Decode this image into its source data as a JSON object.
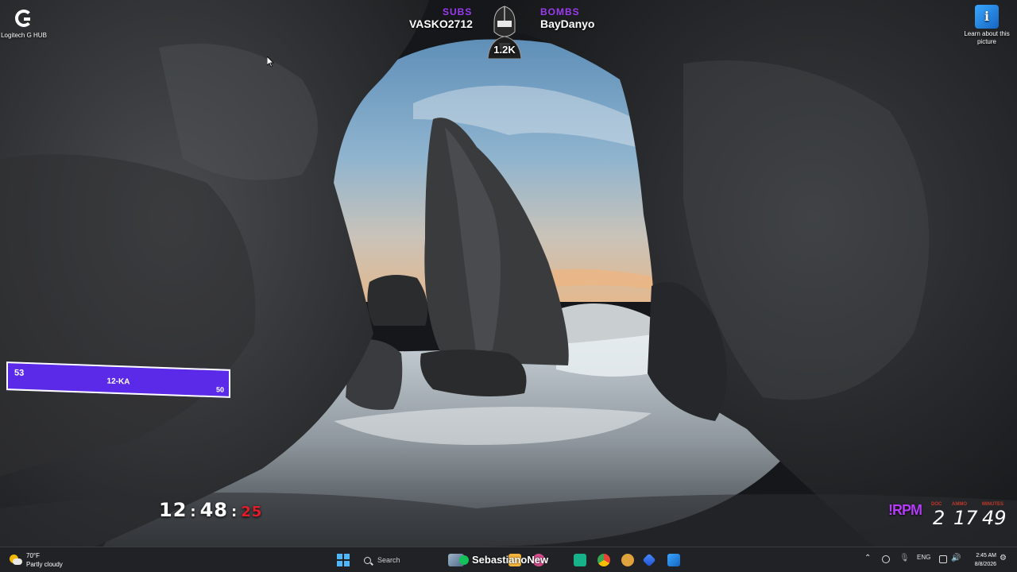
{
  "desktop": {
    "icons": [
      {
        "label": "Logitech G HUB",
        "icon": "logitech-g-hub-icon"
      },
      {
        "label": "Learn about this picture",
        "icon": "info-picture-icon"
      }
    ]
  },
  "overlay": {
    "subs_label": "SUBS",
    "subs_name": "VASKO2712",
    "bombs_label": "BOMBS",
    "bombs_name": "BayDanyo",
    "avatar_icon": "helmet-mascot-icon",
    "avatar_count": "1.2K",
    "accent_color": "#9b3cf0"
  },
  "level_bar": {
    "left_value": "53",
    "center_label": "12-KA",
    "right_value": "50",
    "color": "#5a2ae8"
  },
  "timer": {
    "hours": "12",
    "minutes": "48",
    "seconds": "25",
    "separator": ":"
  },
  "rpm_widget": {
    "label": "!RPM",
    "captions": [
      "DOC",
      "AMMO",
      "MINUTES"
    ],
    "values": [
      "2",
      "17",
      "49"
    ]
  },
  "taskbar": {
    "weather_temp": "70°F",
    "weather_desc": "Partly cloudy",
    "weather_icon": "partly-cloudy-icon",
    "start_icon": "windows-start-icon",
    "search_placeholder": "Search",
    "active_title": "SebastianoNew",
    "language": "ENG",
    "time": "2:45 AM",
    "date": "8/8/2026",
    "start_color": "#4fb6ff"
  }
}
